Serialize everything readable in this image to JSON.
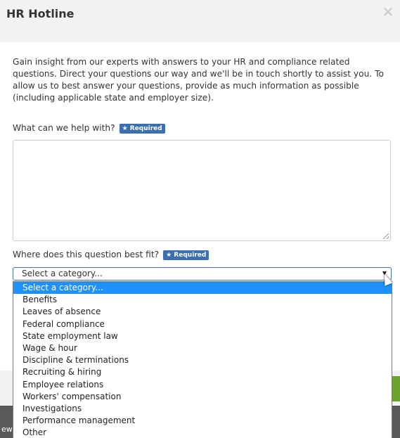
{
  "dialog": {
    "title": "HR Hotline",
    "close_glyph": "✕",
    "intro": "Gain insight from our experts with answers to your HR and compliance related questions. Direct your questions our way and we'll be in touch shortly to assist you. To allow us to best answer your questions, provide as much information as possible (including applicable state and employer size).",
    "question_label": "What can we help with?",
    "category_label": "Where does this question best fit?",
    "required_badge": "★ Required",
    "select_value": "Select a category...",
    "options": [
      "Select a category...",
      "Benefits",
      "Leaves of absence",
      "Federal compliance",
      "State employment law",
      "Wage & hour",
      "Discipline & terminations",
      "Recruiting & hiring",
      "Employee relations",
      "Workers' compensation",
      "Investigations",
      "Performance management",
      "Other"
    ],
    "selected_index": 0
  },
  "background": {
    "partial_text": "ew"
  },
  "colors": {
    "header_bg": "#f2f2f2",
    "required_badge": "#3c6fb0",
    "option_highlight": "#1e90ff",
    "footer_button": "#6aa329"
  },
  "icons": {
    "close": "close-icon",
    "dropdown_arrow": "chevron-down-icon",
    "cursor": "mouse-cursor-icon",
    "resize": "resize-grip-icon"
  }
}
